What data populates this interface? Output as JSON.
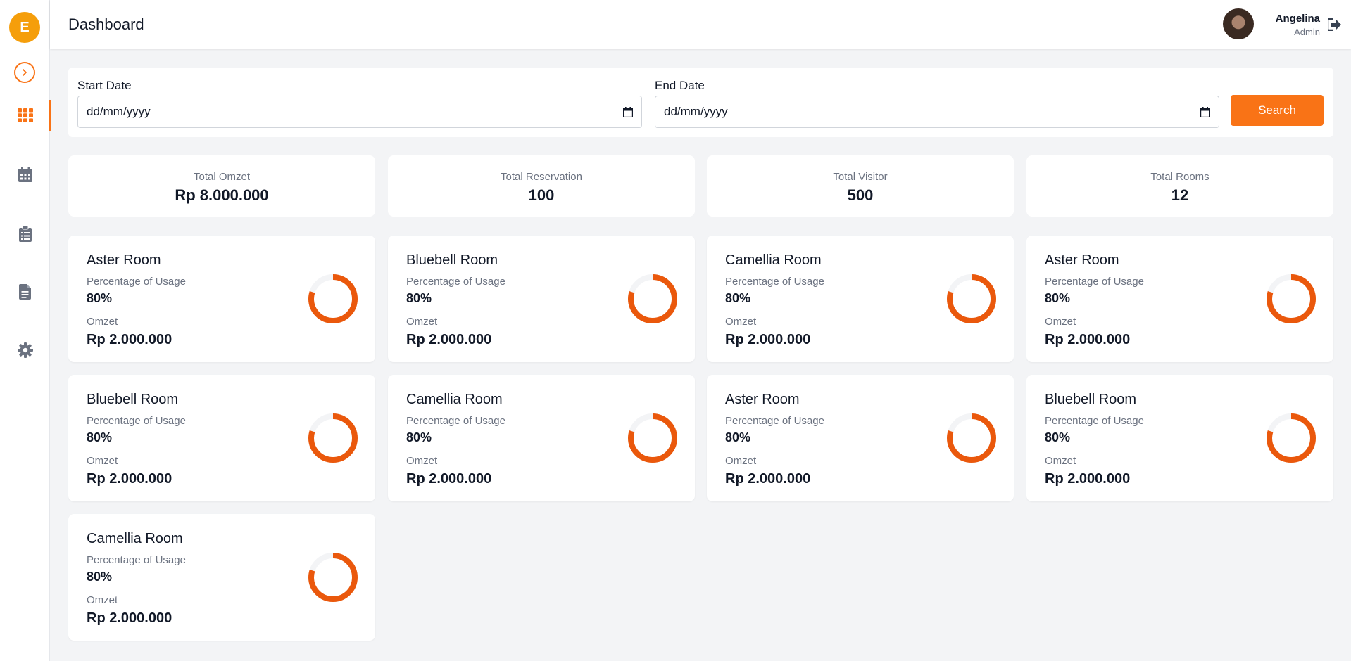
{
  "app": {
    "logo_letter": "E"
  },
  "header": {
    "title": "Dashboard"
  },
  "user": {
    "name": "Angelina",
    "role": "Admin"
  },
  "sidebar": {
    "items": [
      {
        "icon": "grid-icon",
        "active": true
      },
      {
        "icon": "calendar-icon",
        "active": false
      },
      {
        "icon": "clipboard-icon",
        "active": false
      },
      {
        "icon": "document-icon",
        "active": false
      },
      {
        "icon": "gear-icon",
        "active": false
      }
    ]
  },
  "filter": {
    "start_label": "Start Date",
    "end_label": "End Date",
    "start_placeholder": "dd/mm/yyyy",
    "end_placeholder": "dd/mm/yyyy",
    "search_label": "Search"
  },
  "stats": [
    {
      "label": "Total Omzet",
      "value": "Rp 8.000.000"
    },
    {
      "label": "Total Reservation",
      "value": "100"
    },
    {
      "label": "Total Visitor",
      "value": "500"
    },
    {
      "label": "Total Rooms",
      "value": "12"
    }
  ],
  "rooms": [
    {
      "name": "Aster Room",
      "usage_label": "Percentage of Usage",
      "usage": "80%",
      "usage_fraction": 0.8,
      "omzet_label": "Omzet",
      "omzet": "Rp 2.000.000"
    },
    {
      "name": "Bluebell Room",
      "usage_label": "Percentage of Usage",
      "usage": "80%",
      "usage_fraction": 0.8,
      "omzet_label": "Omzet",
      "omzet": "Rp 2.000.000"
    },
    {
      "name": "Camellia Room",
      "usage_label": "Percentage of Usage",
      "usage": "80%",
      "usage_fraction": 0.8,
      "omzet_label": "Omzet",
      "omzet": "Rp 2.000.000"
    },
    {
      "name": "Aster Room",
      "usage_label": "Percentage of Usage",
      "usage": "80%",
      "usage_fraction": 0.8,
      "omzet_label": "Omzet",
      "omzet": "Rp 2.000.000"
    },
    {
      "name": "Bluebell Room",
      "usage_label": "Percentage of Usage",
      "usage": "80%",
      "usage_fraction": 0.8,
      "omzet_label": "Omzet",
      "omzet": "Rp 2.000.000"
    },
    {
      "name": "Camellia Room",
      "usage_label": "Percentage of Usage",
      "usage": "80%",
      "usage_fraction": 0.8,
      "omzet_label": "Omzet",
      "omzet": "Rp 2.000.000"
    },
    {
      "name": "Aster Room",
      "usage_label": "Percentage of Usage",
      "usage": "80%",
      "usage_fraction": 0.8,
      "omzet_label": "Omzet",
      "omzet": "Rp 2.000.000"
    },
    {
      "name": "Bluebell Room",
      "usage_label": "Percentage of Usage",
      "usage": "80%",
      "usage_fraction": 0.8,
      "omzet_label": "Omzet",
      "omzet": "Rp 2.000.000"
    },
    {
      "name": "Camellia Room",
      "usage_label": "Percentage of Usage",
      "usage": "80%",
      "usage_fraction": 0.8,
      "omzet_label": "Omzet",
      "omzet": "Rp 2.000.000"
    }
  ],
  "colors": {
    "accent": "#f97316",
    "donut": "#ea580c",
    "donut_track": "#f3f4f6",
    "logo": "#f59e0b"
  }
}
